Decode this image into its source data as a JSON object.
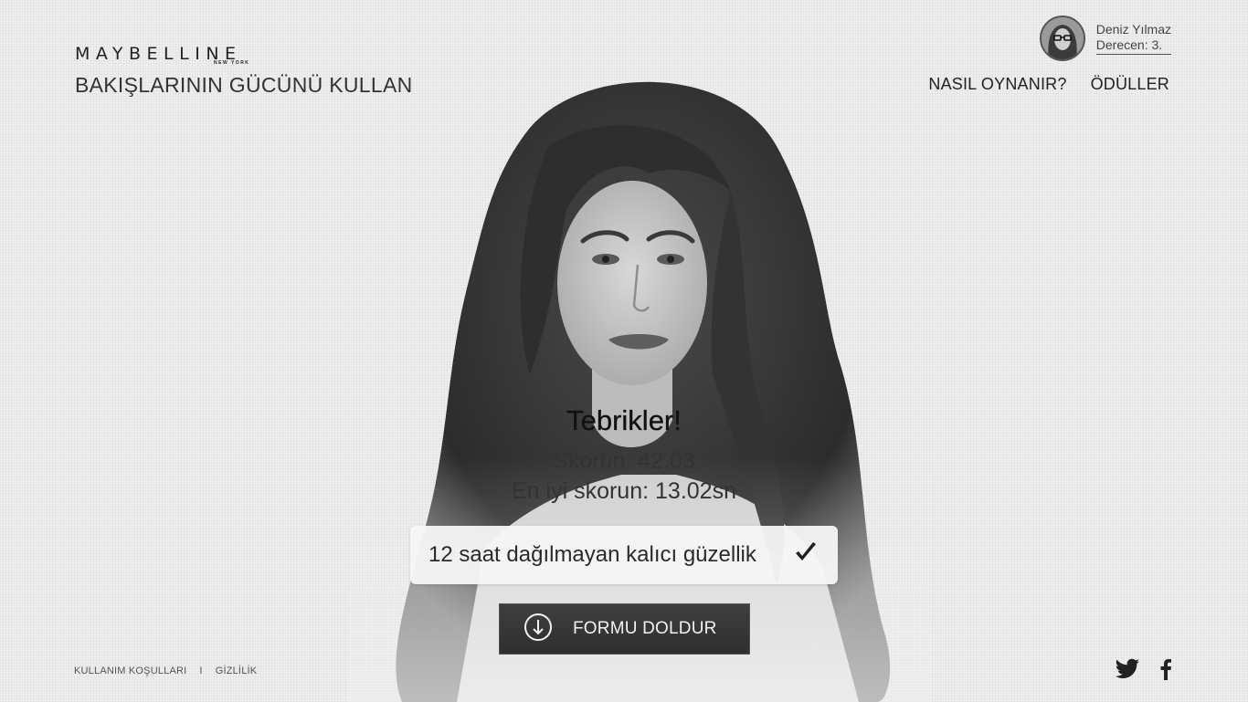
{
  "brand": {
    "logo_text": "MAYBELLINE",
    "logo_sub": "NEW YORK",
    "tagline": "BAKIŞLARININ GÜCÜNÜ KULLAN"
  },
  "user": {
    "name": "Deniz Yılmaz",
    "rank": "Derecen: 3."
  },
  "nav": {
    "how_to_play": "NASIL OYNANIR?",
    "prizes": "ÖDÜLLER"
  },
  "result": {
    "title": "Tebrikler!",
    "score": "Skorun: 42.03",
    "best_score": "En iyi skorun: 13.02sn"
  },
  "benefit": {
    "text": "12 saat dağılmayan kalıcı güzellik",
    "icon": "checkmark-icon"
  },
  "cta": {
    "label": "FORMU DOLDUR",
    "icon": "arrow-down-circle-icon"
  },
  "footer": {
    "terms": "KULLANIM KOŞULLARI",
    "separator": "I",
    "privacy": "GİZLİLİK"
  },
  "social": {
    "twitter_icon": "twitter-icon",
    "facebook_icon": "facebook-icon"
  },
  "colors": {
    "background": "#efefef",
    "text": "#2a2a2a",
    "button": "#363636"
  }
}
